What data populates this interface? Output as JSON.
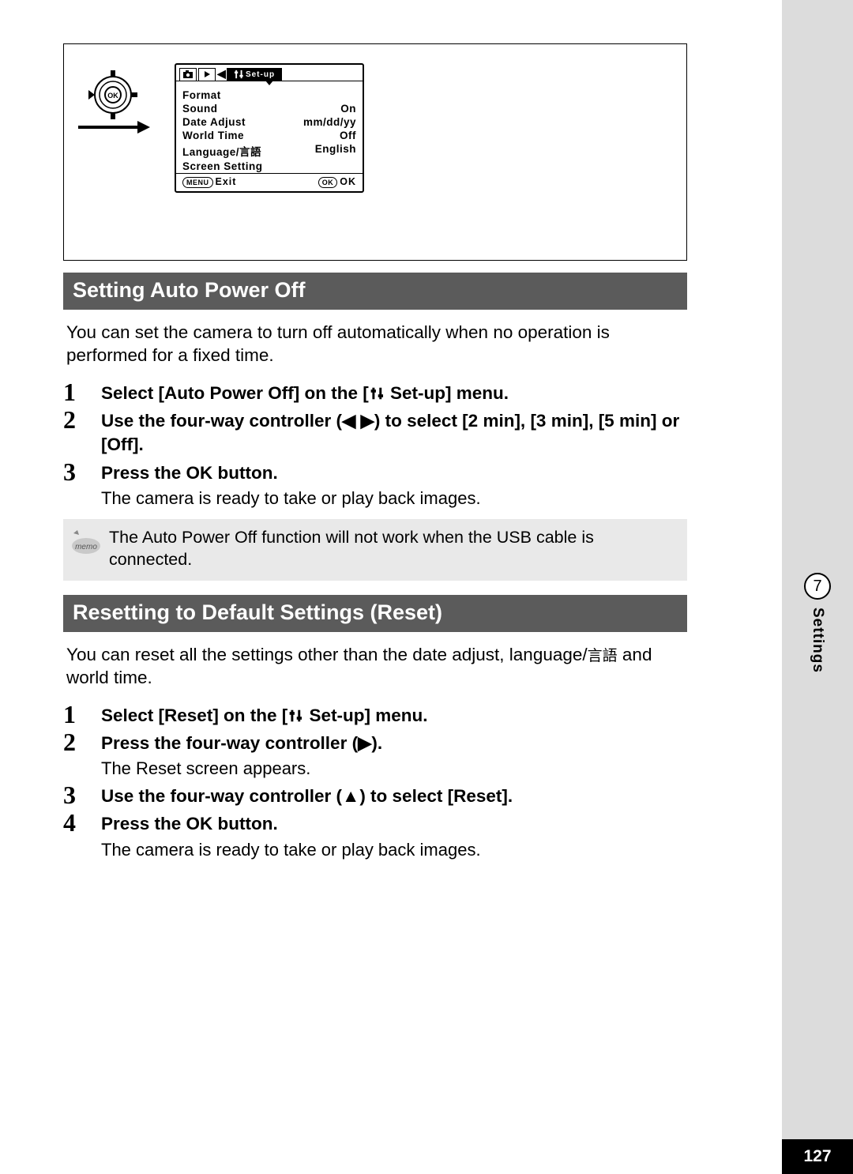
{
  "lcd": {
    "tab_setup": "Set-up",
    "rows": [
      {
        "label": "Format",
        "value": ""
      },
      {
        "label": "Sound",
        "value": "On"
      },
      {
        "label": "Date Adjust",
        "value": "mm/dd/yy"
      },
      {
        "label": "World Time",
        "value": "Off"
      },
      {
        "label": "Language/言語",
        "value": "English"
      },
      {
        "label": "Screen Setting",
        "value": ""
      }
    ],
    "foot_left_btn": "MENU",
    "foot_left": "Exit",
    "foot_right_btn": "OK",
    "foot_right": "OK"
  },
  "section1": {
    "title": "Setting Auto Power Off",
    "intro": "You can set the camera to turn off automatically when no operation is performed for a fixed time.",
    "steps": [
      {
        "n": "1",
        "bold_pre": "Select [Auto Power Off] on the [",
        "bold_post": " Set-up] menu."
      },
      {
        "n": "2",
        "bold": "Use the four-way controller (◀ ▶) to select [2 min], [3 min], [5 min] or [Off]."
      },
      {
        "n": "3",
        "bold": "Press the OK button.",
        "sub": "The camera is ready to take or play back images."
      }
    ],
    "memo": "The Auto Power Off function will not work when the USB cable is connected."
  },
  "section2": {
    "title": "Resetting to Default Settings (Reset)",
    "intro_pre": "You can reset all the settings other than the date adjust, language/",
    "intro_kanji": "言語",
    "intro_post": " and world time.",
    "steps": [
      {
        "n": "1",
        "bold_pre": "Select [Reset] on the [",
        "bold_post": " Set-up] menu."
      },
      {
        "n": "2",
        "bold": "Press the four-way controller (▶).",
        "sub": "The Reset screen appears."
      },
      {
        "n": "3",
        "bold": "Use the four-way controller (▲) to select [Reset]."
      },
      {
        "n": "4",
        "bold": "Press the OK button.",
        "sub": "The camera is ready to take or play back images."
      }
    ]
  },
  "side": {
    "chapter": "7",
    "label": "Settings"
  },
  "page_number": "127"
}
